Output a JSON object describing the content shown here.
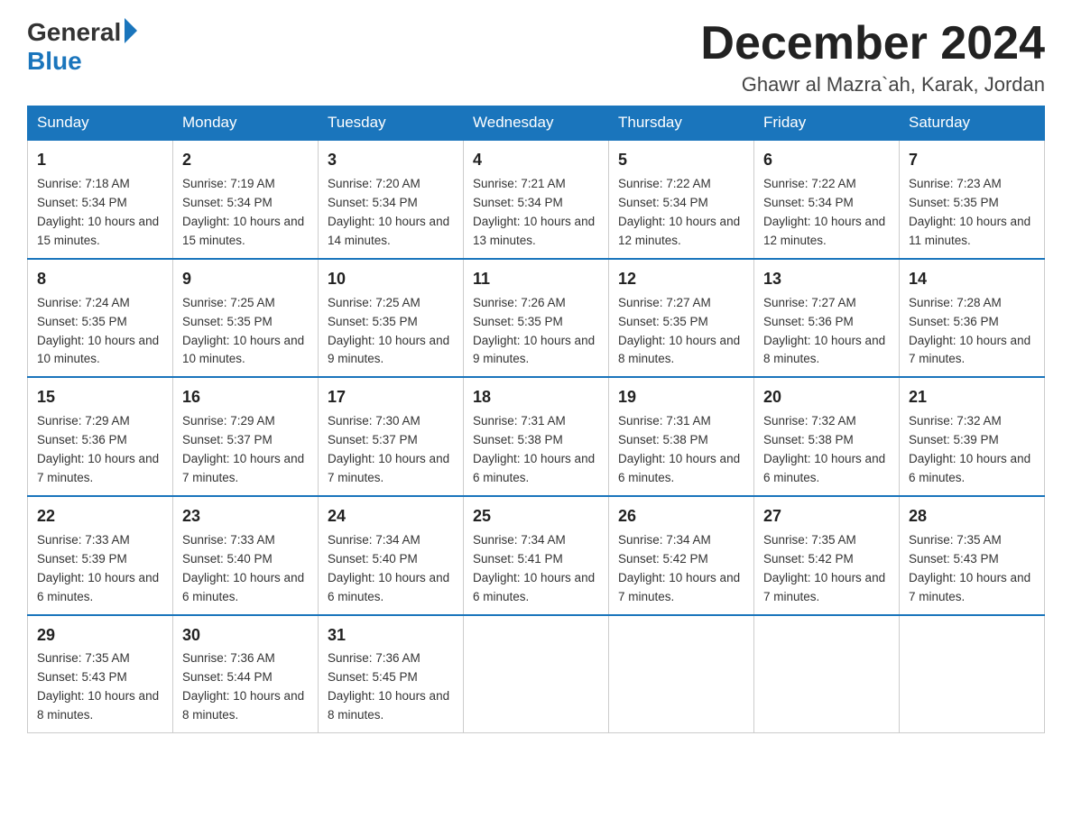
{
  "logo": {
    "general": "General",
    "blue": "Blue"
  },
  "header": {
    "month": "December 2024",
    "location": "Ghawr al Mazra`ah, Karak, Jordan"
  },
  "days_of_week": [
    "Sunday",
    "Monday",
    "Tuesday",
    "Wednesday",
    "Thursday",
    "Friday",
    "Saturday"
  ],
  "weeks": [
    [
      {
        "date": "1",
        "sunrise": "7:18 AM",
        "sunset": "5:34 PM",
        "daylight": "10 hours and 15 minutes."
      },
      {
        "date": "2",
        "sunrise": "7:19 AM",
        "sunset": "5:34 PM",
        "daylight": "10 hours and 15 minutes."
      },
      {
        "date": "3",
        "sunrise": "7:20 AM",
        "sunset": "5:34 PM",
        "daylight": "10 hours and 14 minutes."
      },
      {
        "date": "4",
        "sunrise": "7:21 AM",
        "sunset": "5:34 PM",
        "daylight": "10 hours and 13 minutes."
      },
      {
        "date": "5",
        "sunrise": "7:22 AM",
        "sunset": "5:34 PM",
        "daylight": "10 hours and 12 minutes."
      },
      {
        "date": "6",
        "sunrise": "7:22 AM",
        "sunset": "5:34 PM",
        "daylight": "10 hours and 12 minutes."
      },
      {
        "date": "7",
        "sunrise": "7:23 AM",
        "sunset": "5:35 PM",
        "daylight": "10 hours and 11 minutes."
      }
    ],
    [
      {
        "date": "8",
        "sunrise": "7:24 AM",
        "sunset": "5:35 PM",
        "daylight": "10 hours and 10 minutes."
      },
      {
        "date": "9",
        "sunrise": "7:25 AM",
        "sunset": "5:35 PM",
        "daylight": "10 hours and 10 minutes."
      },
      {
        "date": "10",
        "sunrise": "7:25 AM",
        "sunset": "5:35 PM",
        "daylight": "10 hours and 9 minutes."
      },
      {
        "date": "11",
        "sunrise": "7:26 AM",
        "sunset": "5:35 PM",
        "daylight": "10 hours and 9 minutes."
      },
      {
        "date": "12",
        "sunrise": "7:27 AM",
        "sunset": "5:35 PM",
        "daylight": "10 hours and 8 minutes."
      },
      {
        "date": "13",
        "sunrise": "7:27 AM",
        "sunset": "5:36 PM",
        "daylight": "10 hours and 8 minutes."
      },
      {
        "date": "14",
        "sunrise": "7:28 AM",
        "sunset": "5:36 PM",
        "daylight": "10 hours and 7 minutes."
      }
    ],
    [
      {
        "date": "15",
        "sunrise": "7:29 AM",
        "sunset": "5:36 PM",
        "daylight": "10 hours and 7 minutes."
      },
      {
        "date": "16",
        "sunrise": "7:29 AM",
        "sunset": "5:37 PM",
        "daylight": "10 hours and 7 minutes."
      },
      {
        "date": "17",
        "sunrise": "7:30 AM",
        "sunset": "5:37 PM",
        "daylight": "10 hours and 7 minutes."
      },
      {
        "date": "18",
        "sunrise": "7:31 AM",
        "sunset": "5:38 PM",
        "daylight": "10 hours and 6 minutes."
      },
      {
        "date": "19",
        "sunrise": "7:31 AM",
        "sunset": "5:38 PM",
        "daylight": "10 hours and 6 minutes."
      },
      {
        "date": "20",
        "sunrise": "7:32 AM",
        "sunset": "5:38 PM",
        "daylight": "10 hours and 6 minutes."
      },
      {
        "date": "21",
        "sunrise": "7:32 AM",
        "sunset": "5:39 PM",
        "daylight": "10 hours and 6 minutes."
      }
    ],
    [
      {
        "date": "22",
        "sunrise": "7:33 AM",
        "sunset": "5:39 PM",
        "daylight": "10 hours and 6 minutes."
      },
      {
        "date": "23",
        "sunrise": "7:33 AM",
        "sunset": "5:40 PM",
        "daylight": "10 hours and 6 minutes."
      },
      {
        "date": "24",
        "sunrise": "7:34 AM",
        "sunset": "5:40 PM",
        "daylight": "10 hours and 6 minutes."
      },
      {
        "date": "25",
        "sunrise": "7:34 AM",
        "sunset": "5:41 PM",
        "daylight": "10 hours and 6 minutes."
      },
      {
        "date": "26",
        "sunrise": "7:34 AM",
        "sunset": "5:42 PM",
        "daylight": "10 hours and 7 minutes."
      },
      {
        "date": "27",
        "sunrise": "7:35 AM",
        "sunset": "5:42 PM",
        "daylight": "10 hours and 7 minutes."
      },
      {
        "date": "28",
        "sunrise": "7:35 AM",
        "sunset": "5:43 PM",
        "daylight": "10 hours and 7 minutes."
      }
    ],
    [
      {
        "date": "29",
        "sunrise": "7:35 AM",
        "sunset": "5:43 PM",
        "daylight": "10 hours and 8 minutes."
      },
      {
        "date": "30",
        "sunrise": "7:36 AM",
        "sunset": "5:44 PM",
        "daylight": "10 hours and 8 minutes."
      },
      {
        "date": "31",
        "sunrise": "7:36 AM",
        "sunset": "5:45 PM",
        "daylight": "10 hours and 8 minutes."
      },
      {
        "date": "",
        "sunrise": "",
        "sunset": "",
        "daylight": ""
      },
      {
        "date": "",
        "sunrise": "",
        "sunset": "",
        "daylight": ""
      },
      {
        "date": "",
        "sunrise": "",
        "sunset": "",
        "daylight": ""
      },
      {
        "date": "",
        "sunrise": "",
        "sunset": "",
        "daylight": ""
      }
    ]
  ]
}
